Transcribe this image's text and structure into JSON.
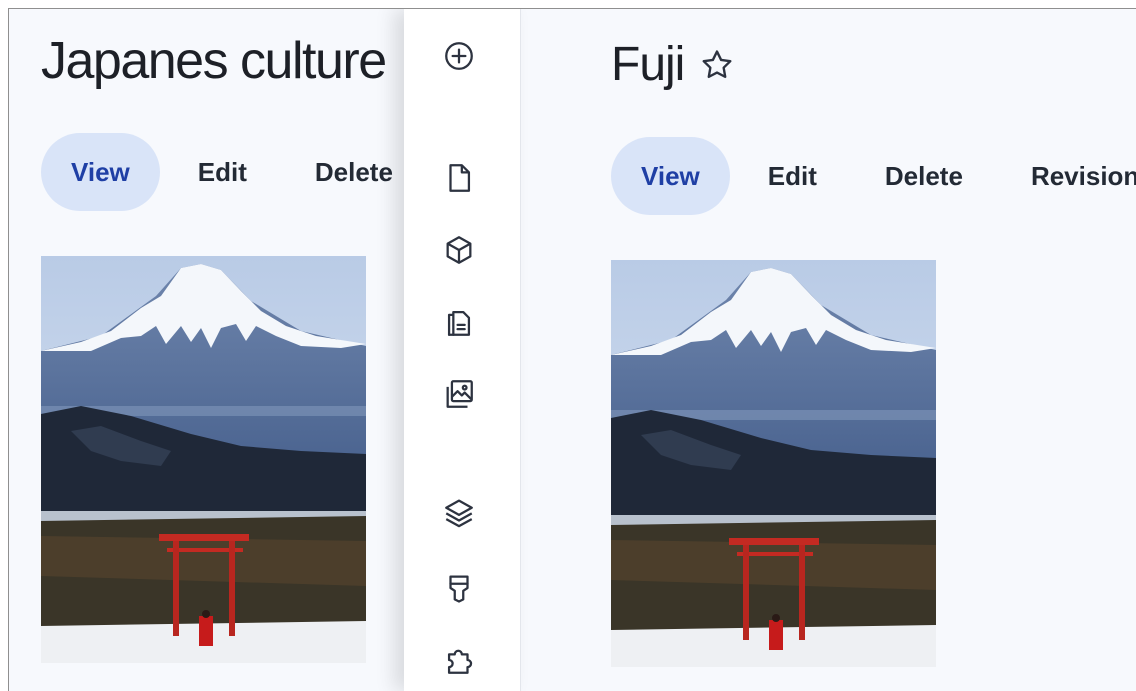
{
  "background_page": {
    "title": "Japanes culture",
    "tabs": [
      {
        "label": "View",
        "active": true
      },
      {
        "label": "Edit",
        "active": false
      },
      {
        "label": "Delete",
        "active": false
      }
    ]
  },
  "toolbar": {
    "icons": [
      "add-circle-icon",
      "file-icon",
      "cube-icon",
      "documents-icon",
      "image-icon",
      "layers-icon",
      "brush-icon",
      "puzzle-icon"
    ]
  },
  "foreground_page": {
    "title": "Fuji",
    "tabs": [
      {
        "label": "View",
        "active": true
      },
      {
        "label": "Edit",
        "active": false
      },
      {
        "label": "Delete",
        "active": false
      },
      {
        "label": "Revisions",
        "active": false
      }
    ]
  },
  "colors": {
    "active_tab_bg": "#d9e4f8",
    "active_tab_text": "#1f3fa5",
    "page_bg": "#f7f9fd",
    "title_text": "#1d2027"
  }
}
